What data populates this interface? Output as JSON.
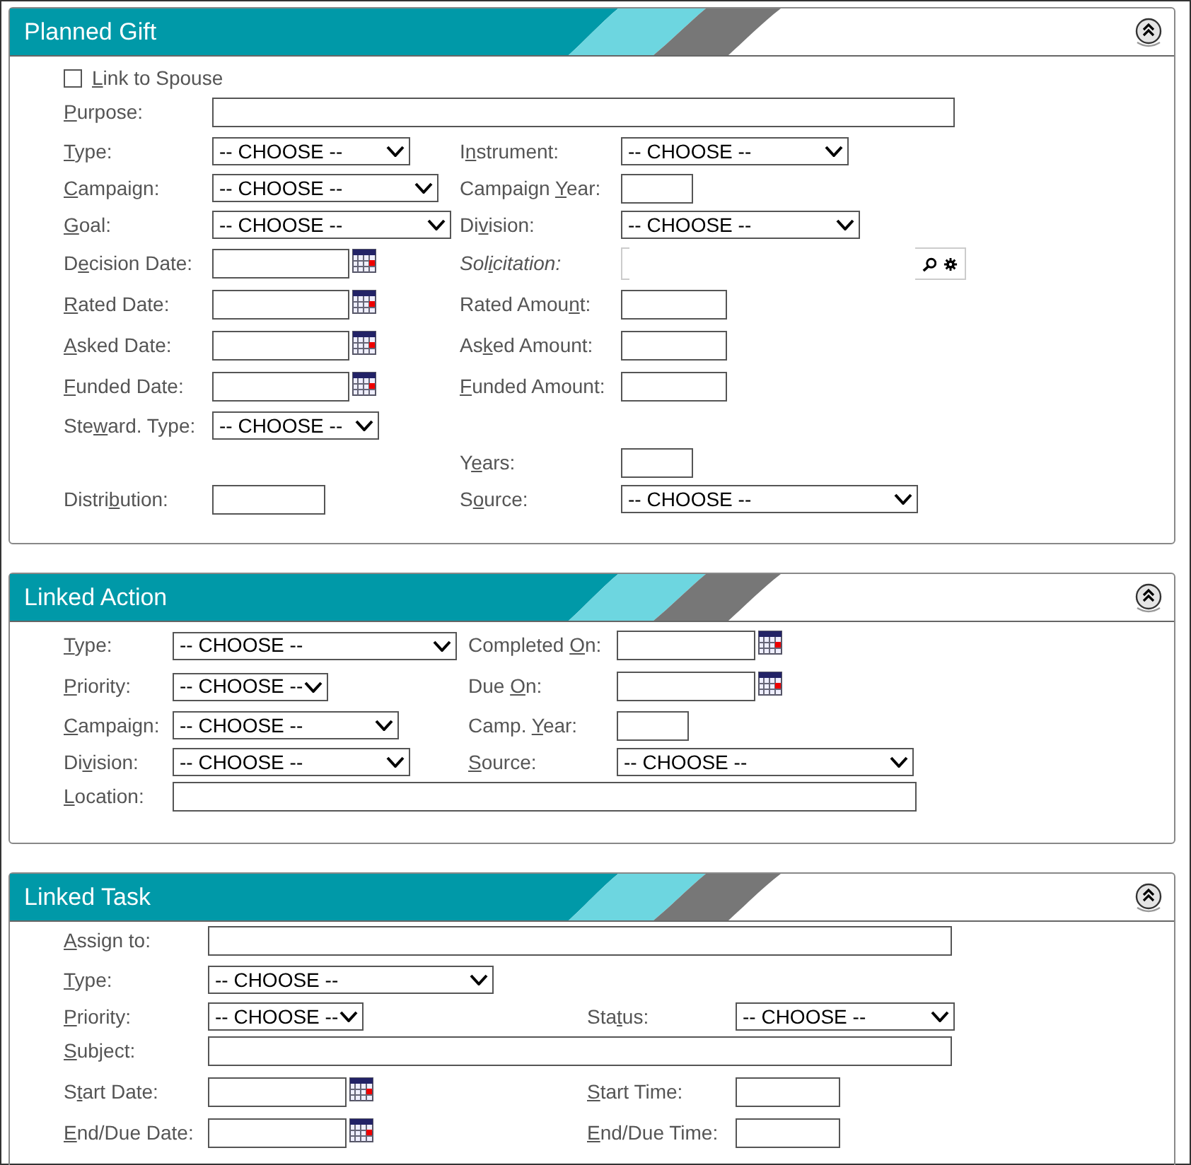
{
  "sections": [
    {
      "title": "Planned Gift",
      "expanded": true,
      "rows": [
        {
          "left": {
            "kind": "checkbox",
            "checked": false,
            "label": {
              "key": "L",
              "post": "ink to Spouse"
            }
          }
        },
        {
          "left": {
            "kind": "longtext",
            "label": {
              "key": "P",
              "post": "urpose:"
            }
          }
        },
        {
          "left": {
            "kind": "select",
            "label": {
              "key": "T",
              "post": "ype:"
            },
            "value": "-- CHOOSE --"
          },
          "right": {
            "kind": "select",
            "label": {
              "pre": "I",
              "key": "n",
              "post": "strument:"
            },
            "value": "-- CHOOSE --"
          }
        },
        {
          "left": {
            "kind": "select",
            "label": {
              "key": "C",
              "post": "ampaign:"
            },
            "value": "-- CHOOSE --"
          },
          "right": {
            "kind": "text",
            "label": {
              "pre": "Campaign ",
              "key": "Y",
              "post": "ear:"
            }
          }
        },
        {
          "left": {
            "kind": "select",
            "label": {
              "key": "G",
              "post": "oal:"
            },
            "value": "-- CHOOSE --"
          },
          "right": {
            "kind": "select",
            "label": {
              "pre": "Di",
              "key": "v",
              "post": "ision:"
            },
            "value": "-- CHOOSE --"
          }
        },
        {
          "left": {
            "kind": "date",
            "label": {
              "pre": "D",
              "key": "e",
              "post": "cision Date:"
            }
          },
          "right": {
            "kind": "lookup",
            "label": {
              "pre": "Sol",
              "key": "i",
              "post": "citation:"
            }
          }
        },
        {
          "left": {
            "kind": "date",
            "label": {
              "key": "R",
              "post": "ated Date:"
            }
          },
          "right": {
            "kind": "text",
            "label": {
              "pre": "Rated Amou",
              "key": "n",
              "post": "t:"
            }
          }
        },
        {
          "left": {
            "kind": "date",
            "label": {
              "key": "A",
              "post": "sked Date:"
            }
          },
          "right": {
            "kind": "text",
            "label": {
              "pre": "As",
              "key": "k",
              "post": "ed Amount:"
            }
          }
        },
        {
          "left": {
            "kind": "date",
            "label": {
              "key": "F",
              "post": "unded Date:"
            }
          },
          "right": {
            "kind": "text",
            "label": {
              "key": "F",
              "post": "unded Amount:"
            }
          }
        },
        {
          "left": {
            "kind": "select",
            "label": {
              "pre": "Ste",
              "key": "w",
              "post": "ard. Type:"
            },
            "value": "-- CHOOSE --"
          }
        },
        {
          "right": {
            "kind": "text",
            "label": {
              "pre": "Y",
              "key": "e",
              "post": "ars:"
            }
          }
        },
        {
          "left": {
            "kind": "text",
            "label": {
              "pre": "Distri",
              "key": "b",
              "post": "ution:"
            }
          },
          "right": {
            "kind": "select",
            "label": {
              "pre": "S",
              "key": "o",
              "post": "urce:"
            },
            "value": "-- CHOOSE --"
          }
        }
      ]
    },
    {
      "title": "Linked Action",
      "expanded": true,
      "rows": [
        {
          "left": {
            "kind": "select",
            "label": {
              "key": "T",
              "post": "ype:"
            },
            "value": "-- CHOOSE --"
          },
          "right": {
            "kind": "date",
            "label": {
              "pre": "Completed ",
              "key": "O",
              "post": "n:"
            }
          }
        },
        {
          "left": {
            "kind": "select",
            "label": {
              "key": "P",
              "post": "riority:"
            },
            "value": "-- CHOOSE --"
          },
          "right": {
            "kind": "date",
            "label": {
              "pre": "Due ",
              "key": "O",
              "post": "n:"
            }
          }
        },
        {
          "left": {
            "kind": "select",
            "label": {
              "key": "C",
              "post": "ampaign:"
            },
            "value": "-- CHOOSE --"
          },
          "right": {
            "kind": "text",
            "label": {
              "pre": "Camp. ",
              "key": "Y",
              "post": "ear:"
            }
          }
        },
        {
          "left": {
            "kind": "select",
            "label": {
              "pre": "Di",
              "key": "v",
              "post": "ision:"
            },
            "value": "-- CHOOSE --"
          },
          "right": {
            "kind": "select",
            "label": {
              "key": "S",
              "post": "ource:"
            },
            "value": "-- CHOOSE --"
          }
        },
        {
          "left": {
            "kind": "longtext",
            "label": {
              "key": "L",
              "post": "ocation:"
            }
          }
        }
      ]
    },
    {
      "title": "Linked Task",
      "expanded": true,
      "rows": [
        {
          "left": {
            "kind": "longtext",
            "label": {
              "key": "A",
              "post": "ssign to:"
            }
          }
        },
        {
          "left": {
            "kind": "select",
            "label": {
              "key": "T",
              "post": "ype:"
            },
            "value": "-- CHOOSE --"
          }
        },
        {
          "left": {
            "kind": "select",
            "label": {
              "key": "P",
              "post": "riority:"
            },
            "value": "-- CHOOSE --"
          },
          "right": {
            "kind": "select",
            "label": {
              "pre": "Sta",
              "key": "t",
              "post": "us:"
            },
            "value": "-- CHOOSE --"
          }
        },
        {
          "left": {
            "kind": "longtext",
            "label": {
              "key": "S",
              "post": "ubject:"
            }
          }
        },
        {
          "left": {
            "kind": "date",
            "label": {
              "pre": "S",
              "key": "t",
              "post": "art Date:"
            }
          },
          "right": {
            "kind": "text",
            "label": {
              "key": "S",
              "post": "tart Time:"
            }
          }
        },
        {
          "left": {
            "kind": "date",
            "label": {
              "key": "E",
              "post": "nd/Due Date:"
            }
          },
          "right": {
            "kind": "text",
            "label": {
              "key": "E",
              "post": "nd/Due Time:"
            }
          }
        }
      ]
    }
  ]
}
